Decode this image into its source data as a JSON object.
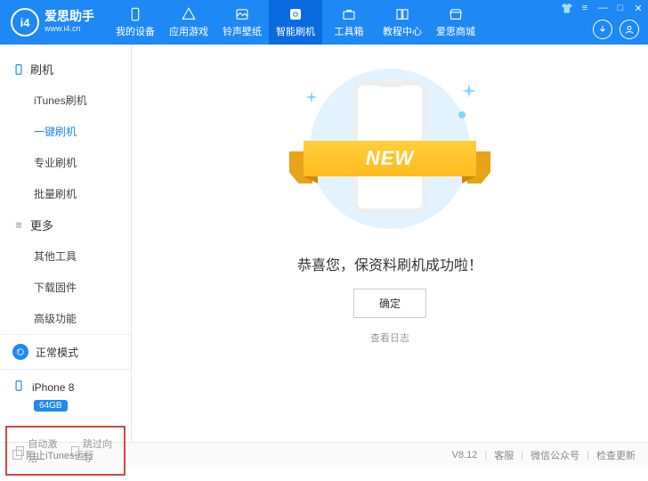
{
  "header": {
    "brand_cn": "爱思助手",
    "brand_en": "www.i4.cn",
    "tabs": [
      {
        "label": "我的设备"
      },
      {
        "label": "应用游戏"
      },
      {
        "label": "铃声壁纸"
      },
      {
        "label": "智能刷机"
      },
      {
        "label": "工具箱"
      },
      {
        "label": "教程中心"
      },
      {
        "label": "爱思商城"
      }
    ]
  },
  "sidebar": {
    "cat1": "刷机",
    "items1": [
      "iTunes刷机",
      "一键刷机",
      "专业刷机",
      "批量刷机"
    ],
    "cat2": "更多",
    "items2": [
      "其他工具",
      "下载固件",
      "高级功能"
    ],
    "mode": "正常模式",
    "device": "iPhone 8",
    "storage": "64GB",
    "auto_activate": "自动激活",
    "skip_guide": "跳过向导"
  },
  "main": {
    "ribbon": "NEW",
    "success": "恭喜您，保资料刷机成功啦！",
    "ok": "确定",
    "view_log": "查看日志"
  },
  "statusbar": {
    "block_itunes": "阻止iTunes运行",
    "version": "V8.12",
    "support": "客服",
    "wechat": "微信公众号",
    "update": "检查更新"
  }
}
